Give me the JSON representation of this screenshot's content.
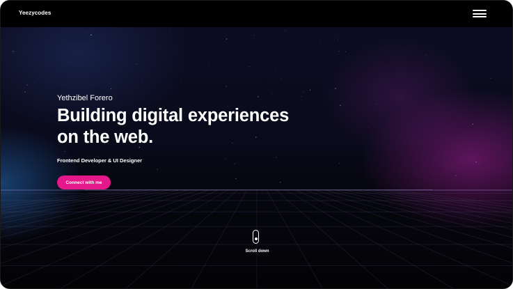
{
  "header": {
    "brand": "Yeezycodes",
    "menu_icon": "hamburger-menu-icon"
  },
  "hero": {
    "name": "Yethzibel Forero",
    "headline_line1": "Building digital experiences",
    "headline_line2": "on the web.",
    "role": "Frontend Developer & UI Designer",
    "cta_label": "Connect with me",
    "scroll_label": "Scroll down",
    "scroll_icon": "mouse-scroll-icon"
  },
  "colors": {
    "background": "#05050b",
    "navbar": "#000000",
    "accent": "#e5188a",
    "text": "#ffffff",
    "glow_blue": "#286ebe",
    "glow_magenta": "#a51e96"
  }
}
